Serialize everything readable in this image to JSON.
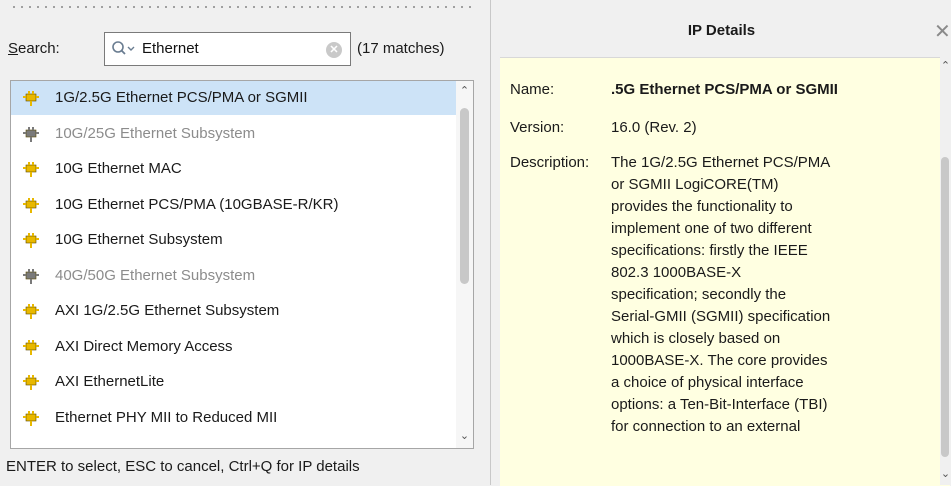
{
  "search": {
    "label_prefix": "S",
    "label_rest": "earch:",
    "value": "Ethernet",
    "match_count": "(17 matches)"
  },
  "results": [
    {
      "label": "1G/2.5G Ethernet PCS/PMA or SGMII",
      "selected": true,
      "enabled": true
    },
    {
      "label": "10G/25G Ethernet Subsystem",
      "selected": false,
      "enabled": false
    },
    {
      "label": "10G Ethernet MAC",
      "selected": false,
      "enabled": true
    },
    {
      "label": "10G Ethernet PCS/PMA (10GBASE-R/KR)",
      "selected": false,
      "enabled": true
    },
    {
      "label": "10G Ethernet Subsystem",
      "selected": false,
      "enabled": true
    },
    {
      "label": "40G/50G Ethernet Subsystem",
      "selected": false,
      "enabled": false
    },
    {
      "label": "AXI 1G/2.5G Ethernet Subsystem",
      "selected": false,
      "enabled": true
    },
    {
      "label": "AXI Direct Memory Access",
      "selected": false,
      "enabled": true
    },
    {
      "label": "AXI EthernetLite",
      "selected": false,
      "enabled": true
    },
    {
      "label": "Ethernet PHY MII to Reduced MII",
      "selected": false,
      "enabled": true
    }
  ],
  "status_bar": "ENTER to select, ESC to cancel, Ctrl+Q for IP details",
  "details": {
    "title": "IP Details",
    "name_label": "Name:",
    "name_value": ".5G Ethernet PCS/PMA or SGMII",
    "version_label": "Version:",
    "version_value": "16.0 (Rev. 2)",
    "description_label": "Description:",
    "description_lines": [
      "The 1G/2.5G Ethernet PCS/PMA",
      "or SGMII LogiCORE(TM)",
      "provides the functionality to",
      "implement one of two different",
      "specifications: firstly the IEEE",
      "802.3 1000BASE-X",
      "specification; secondly the",
      "Serial-GMII (SGMII) specification",
      "which is closely based on",
      "1000BASE-X.  The core provides",
      "a choice of physical interface",
      "options: a Ten-Bit-Interface (TBI)",
      "for connection to an external"
    ]
  },
  "colors": {
    "selected_row": "#cde3f7",
    "details_background": "#ffffe1",
    "ip_icon_enabled": "#e8b800",
    "ip_icon_disabled": "#7a7a7a"
  },
  "icons": {
    "search": "search-icon",
    "clear": "clear-icon",
    "ip": "ip-core-icon",
    "close": "close-icon"
  }
}
